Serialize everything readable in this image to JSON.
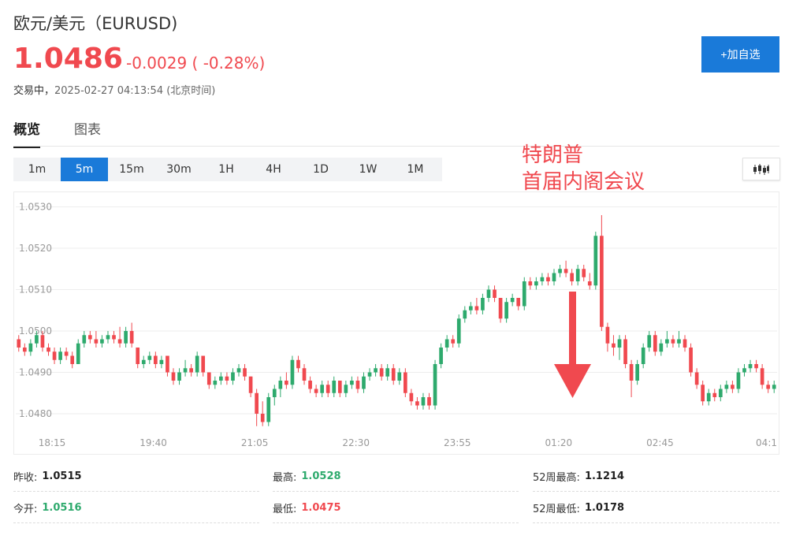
{
  "header": {
    "title": "欧元/美元（EURUSD)",
    "price": "1.0486",
    "change": "-0.0029 ( -0.28%)",
    "status_label": "交易中，",
    "timestamp": "2025-02-27 04:13:54 (北京时间)",
    "add_button": "+加自选"
  },
  "tabs": [
    {
      "label": "概览"
    },
    {
      "label": "图表"
    }
  ],
  "periods": [
    "1m",
    "5m",
    "15m",
    "30m",
    "1H",
    "4H",
    "1D",
    "1W",
    "1M"
  ],
  "active_period": "5m",
  "annotation": "特朗普\n首届内阁会议",
  "colors": {
    "up": "#2eaa6d",
    "down": "#f0494f",
    "accent": "#1a7ad9"
  },
  "stats": {
    "prev_close": {
      "label": "昨收:",
      "value": "1.0515"
    },
    "open": {
      "label": "今开:",
      "value": "1.0516"
    },
    "high": {
      "label": "最高:",
      "value": "1.0528"
    },
    "low": {
      "label": "最低:",
      "value": "1.0475"
    },
    "high52": {
      "label": "52周最高:",
      "value": "1.1214"
    },
    "low52": {
      "label": "52周最低:",
      "value": "1.0178"
    }
  },
  "chart_data": {
    "type": "candlestick",
    "y_ticks": [
      "1.0530",
      "1.0520",
      "1.0510",
      "1.0500",
      "1.0490",
      "1.0480"
    ],
    "x_ticks": [
      "18:15",
      "19:40",
      "21:05",
      "22:30",
      "23:55",
      "01:20",
      "02:45",
      "04:1"
    ],
    "ylim": [
      1.0476,
      1.0532
    ],
    "candles": [
      [
        1.0498,
        1.0499,
        1.0495,
        1.0496
      ],
      [
        1.0496,
        1.0497,
        1.0494,
        1.0495
      ],
      [
        1.0495,
        1.0498,
        1.0494,
        1.0497
      ],
      [
        1.0497,
        1.05,
        1.0496,
        1.0499
      ],
      [
        1.0499,
        1.05,
        1.0495,
        1.0496
      ],
      [
        1.0496,
        1.0497,
        1.0494,
        1.0495
      ],
      [
        1.0495,
        1.0496,
        1.0492,
        1.0493
      ],
      [
        1.0493,
        1.0496,
        1.0492,
        1.0495
      ],
      [
        1.0495,
        1.0496,
        1.0493,
        1.0494
      ],
      [
        1.0494,
        1.0495,
        1.0491,
        1.0492
      ],
      [
        1.0492,
        1.0498,
        1.0492,
        1.0497
      ],
      [
        1.0497,
        1.05,
        1.0496,
        1.0499
      ],
      [
        1.0499,
        1.05,
        1.0497,
        1.0498
      ],
      [
        1.0498,
        1.05,
        1.0496,
        1.0497
      ],
      [
        1.0497,
        1.0499,
        1.0496,
        1.0498
      ],
      [
        1.0498,
        1.05,
        1.0497,
        1.0499
      ],
      [
        1.0499,
        1.05,
        1.0497,
        1.0498
      ],
      [
        1.0498,
        1.0501,
        1.0496,
        1.0497
      ],
      [
        1.0497,
        1.0501,
        1.0496,
        1.05
      ],
      [
        1.05,
        1.0502,
        1.0496,
        1.0497
      ],
      [
        1.0496,
        1.0496,
        1.0491,
        1.0492
      ],
      [
        1.0492,
        1.0494,
        1.0491,
        1.0493
      ],
      [
        1.0493,
        1.0495,
        1.0492,
        1.0494
      ],
      [
        1.0494,
        1.0495,
        1.0491,
        1.0492
      ],
      [
        1.0492,
        1.0494,
        1.0491,
        1.0493
      ],
      [
        1.0494,
        1.0494,
        1.0489,
        1.049
      ],
      [
        1.049,
        1.0491,
        1.0487,
        1.0488
      ],
      [
        1.0488,
        1.0491,
        1.0487,
        1.049
      ],
      [
        1.049,
        1.0493,
        1.0489,
        1.0491
      ],
      [
        1.0491,
        1.0492,
        1.0489,
        1.049
      ],
      [
        1.049,
        1.0495,
        1.0489,
        1.0494
      ],
      [
        1.0494,
        1.0494,
        1.0489,
        1.049
      ],
      [
        1.049,
        1.049,
        1.0486,
        1.0487
      ],
      [
        1.0487,
        1.0489,
        1.0486,
        1.0488
      ],
      [
        1.0488,
        1.049,
        1.0487,
        1.0489
      ],
      [
        1.0489,
        1.049,
        1.0487,
        1.0488
      ],
      [
        1.0488,
        1.0491,
        1.0487,
        1.049
      ],
      [
        1.049,
        1.0492,
        1.0489,
        1.0491
      ],
      [
        1.0491,
        1.0492,
        1.0488,
        1.0489
      ],
      [
        1.0489,
        1.0489,
        1.0484,
        1.0485
      ],
      [
        1.0485,
        1.0486,
        1.0477,
        1.048
      ],
      [
        1.048,
        1.0483,
        1.0477,
        1.0478
      ],
      [
        1.0478,
        1.0485,
        1.0477,
        1.0484
      ],
      [
        1.0484,
        1.0487,
        1.0482,
        1.0486
      ],
      [
        1.0486,
        1.0489,
        1.0484,
        1.0488
      ],
      [
        1.0488,
        1.049,
        1.0486,
        1.0487
      ],
      [
        1.0487,
        1.0494,
        1.0486,
        1.0493
      ],
      [
        1.0493,
        1.0494,
        1.049,
        1.0491
      ],
      [
        1.0491,
        1.0492,
        1.0487,
        1.0488
      ],
      [
        1.0488,
        1.0489,
        1.0485,
        1.0486
      ],
      [
        1.0486,
        1.0487,
        1.0484,
        1.0485
      ],
      [
        1.0485,
        1.0488,
        1.0484,
        1.0487
      ],
      [
        1.0487,
        1.0488,
        1.0484,
        1.0485
      ],
      [
        1.0485,
        1.0489,
        1.0484,
        1.0488
      ],
      [
        1.0488,
        1.0488,
        1.0484,
        1.0485
      ],
      [
        1.0485,
        1.0488,
        1.0484,
        1.0487
      ],
      [
        1.0487,
        1.0489,
        1.0486,
        1.0488
      ],
      [
        1.0488,
        1.0489,
        1.0485,
        1.0486
      ],
      [
        1.0486,
        1.049,
        1.0485,
        1.0489
      ],
      [
        1.0489,
        1.0491,
        1.0488,
        1.049
      ],
      [
        1.049,
        1.0492,
        1.0489,
        1.0491
      ],
      [
        1.0491,
        1.0492,
        1.0488,
        1.0489
      ],
      [
        1.0489,
        1.0492,
        1.0488,
        1.0491
      ],
      [
        1.0491,
        1.0492,
        1.0487,
        1.0488
      ],
      [
        1.0488,
        1.0491,
        1.0487,
        1.049
      ],
      [
        1.049,
        1.0491,
        1.0484,
        1.0485
      ],
      [
        1.0485,
        1.0486,
        1.0482,
        1.0483
      ],
      [
        1.0483,
        1.0484,
        1.0481,
        1.0482
      ],
      [
        1.0482,
        1.0485,
        1.0481,
        1.0484
      ],
      [
        1.0484,
        1.0485,
        1.0481,
        1.0482
      ],
      [
        1.0482,
        1.0493,
        1.0481,
        1.0492
      ],
      [
        1.0492,
        1.0497,
        1.0491,
        1.0496
      ],
      [
        1.0496,
        1.0499,
        1.0495,
        1.0498
      ],
      [
        1.0498,
        1.0499,
        1.0496,
        1.0497
      ],
      [
        1.0497,
        1.0504,
        1.0496,
        1.0503
      ],
      [
        1.0503,
        1.0506,
        1.0502,
        1.0505
      ],
      [
        1.0505,
        1.0507,
        1.0504,
        1.0506
      ],
      [
        1.0506,
        1.0508,
        1.0504,
        1.0505
      ],
      [
        1.0505,
        1.0509,
        1.0504,
        1.0508
      ],
      [
        1.0508,
        1.0511,
        1.0507,
        1.051
      ],
      [
        1.051,
        1.0511,
        1.0507,
        1.0508
      ],
      [
        1.0508,
        1.0508,
        1.0502,
        1.0503
      ],
      [
        1.0503,
        1.0508,
        1.0502,
        1.0507
      ],
      [
        1.0507,
        1.0509,
        1.0506,
        1.0508
      ],
      [
        1.0508,
        1.0508,
        1.0505,
        1.0506
      ],
      [
        1.0506,
        1.0513,
        1.0505,
        1.0512
      ],
      [
        1.0512,
        1.0513,
        1.051,
        1.0511
      ],
      [
        1.0511,
        1.0513,
        1.051,
        1.0512
      ],
      [
        1.0512,
        1.0514,
        1.0511,
        1.0513
      ],
      [
        1.0513,
        1.0514,
        1.0511,
        1.0512
      ],
      [
        1.0512,
        1.0515,
        1.0511,
        1.0514
      ],
      [
        1.0514,
        1.0516,
        1.0513,
        1.0515
      ],
      [
        1.0515,
        1.0517,
        1.0513,
        1.0514
      ],
      [
        1.0514,
        1.0515,
        1.0511,
        1.0512
      ],
      [
        1.0512,
        1.0516,
        1.0511,
        1.0515
      ],
      [
        1.0515,
        1.0516,
        1.0512,
        1.0513
      ],
      [
        1.0512,
        1.0514,
        1.051,
        1.0511
      ],
      [
        1.0511,
        1.0524,
        1.051,
        1.0523
      ],
      [
        1.0523,
        1.0528,
        1.05,
        1.0501
      ],
      [
        1.0501,
        1.0502,
        1.0495,
        1.0497
      ],
      [
        1.0497,
        1.0499,
        1.0494,
        1.0496
      ],
      [
        1.0496,
        1.0499,
        1.0493,
        1.0498
      ],
      [
        1.0498,
        1.0499,
        1.0491,
        1.0492
      ],
      [
        1.0492,
        1.0493,
        1.0484,
        1.0488
      ],
      [
        1.0488,
        1.0493,
        1.0487,
        1.0492
      ],
      [
        1.0492,
        1.0497,
        1.0491,
        1.0496
      ],
      [
        1.0496,
        1.05,
        1.0495,
        1.0499
      ],
      [
        1.0499,
        1.05,
        1.0494,
        1.0495
      ],
      [
        1.0495,
        1.0498,
        1.0494,
        1.0497
      ],
      [
        1.0497,
        1.05,
        1.0496,
        1.0498
      ],
      [
        1.0498,
        1.0499,
        1.0496,
        1.0497
      ],
      [
        1.0497,
        1.05,
        1.0496,
        1.0498
      ],
      [
        1.0498,
        1.0499,
        1.0495,
        1.0496
      ],
      [
        1.0496,
        1.0497,
        1.0489,
        1.049
      ],
      [
        1.049,
        1.0491,
        1.0486,
        1.0487
      ],
      [
        1.0487,
        1.0488,
        1.0482,
        1.0483
      ],
      [
        1.0483,
        1.0486,
        1.0482,
        1.0485
      ],
      [
        1.0485,
        1.0486,
        1.0483,
        1.0484
      ],
      [
        1.0484,
        1.0487,
        1.0483,
        1.0486
      ],
      [
        1.0486,
        1.0488,
        1.0485,
        1.0487
      ],
      [
        1.0487,
        1.0488,
        1.0485,
        1.0486
      ],
      [
        1.0486,
        1.0491,
        1.0485,
        1.049
      ],
      [
        1.049,
        1.0492,
        1.0489,
        1.0491
      ],
      [
        1.0491,
        1.0493,
        1.049,
        1.0492
      ],
      [
        1.0492,
        1.0493,
        1.049,
        1.0491
      ],
      [
        1.0491,
        1.0492,
        1.0486,
        1.0487
      ],
      [
        1.0487,
        1.0488,
        1.0485,
        1.0486
      ],
      [
        1.0486,
        1.0488,
        1.0485,
        1.0487
      ]
    ]
  }
}
